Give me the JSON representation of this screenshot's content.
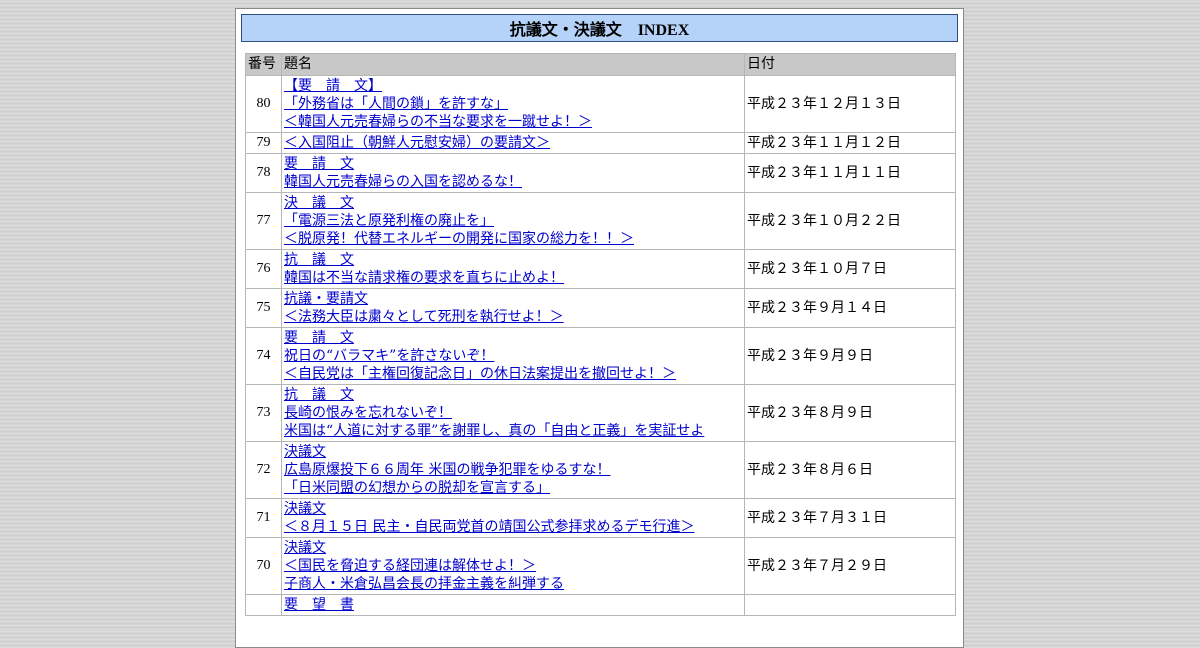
{
  "page": {
    "title": "抗議文・決議文　INDEX"
  },
  "table": {
    "headers": {
      "number": "番号",
      "title": "題名",
      "date": "日付"
    },
    "rows": [
      {
        "number": "80",
        "lines": [
          "【要　請　文】",
          "「外務省は「人間の鎖」を許すな」",
          "＜韓国人元売春婦らの不当な要求を一蹴せよ！＞"
        ],
        "date": "平成２３年１２月１３日"
      },
      {
        "number": "79",
        "lines": [
          "＜入国阻止（朝鮮人元慰安婦）の要請文＞"
        ],
        "date": "平成２３年１１月１２日"
      },
      {
        "number": "78",
        "lines": [
          "要　請　文",
          "韓国人元売春婦らの入国を認めるな！"
        ],
        "date": "平成２３年１１月１１日"
      },
      {
        "number": "77",
        "lines": [
          "決　議　文",
          "「電源三法と原発利権の廃止を」",
          "＜脱原発！代替エネルギーの開発に国家の総力を！！＞"
        ],
        "date": "平成２３年１０月２２日"
      },
      {
        "number": "76",
        "lines": [
          "抗　議　文",
          "韓国は不当な請求権の要求を直ちに止めよ！"
        ],
        "date": "平成２３年１０月７日"
      },
      {
        "number": "75",
        "lines": [
          "抗議・要請文",
          "＜法務大臣は粛々として死刑を執行せよ！＞"
        ],
        "date": "平成２３年９月１４日"
      },
      {
        "number": "74",
        "lines": [
          "要　請　文",
          "祝日の“バラマキ”を許さないぞ！",
          "＜自民党は「主権回復記念日」の休日法案提出を撤回せよ！＞"
        ],
        "date": "平成２３年９月９日"
      },
      {
        "number": "73",
        "lines": [
          "抗　議　文",
          "長崎の恨みを忘れないぞ！",
          "米国は“人道に対する罪”を謝罪し、真の「自由と正義」を実証せよ"
        ],
        "date": "平成２３年８月９日"
      },
      {
        "number": "72",
        "lines": [
          "決議文",
          "広島原爆投下６６周年 米国の戦争犯罪をゆるすな！",
          "「日米同盟の幻想からの脱却を宣言する」"
        ],
        "date": "平成２３年８月６日"
      },
      {
        "number": "71",
        "lines": [
          "決議文",
          "＜８月１５日 民主・自民両党首の靖国公式参拝求めるデモ行進＞"
        ],
        "date": "平成２３年７月３１日"
      },
      {
        "number": "70",
        "lines": [
          "決議文",
          "＜国民を脅迫する経団連は解体せよ！＞",
          "子商人・米倉弘昌会長の拝金主義を糾弾する"
        ],
        "date": "平成２３年７月２９日"
      },
      {
        "number": "",
        "lines": [
          "要　望　書"
        ],
        "date": ""
      }
    ]
  }
}
